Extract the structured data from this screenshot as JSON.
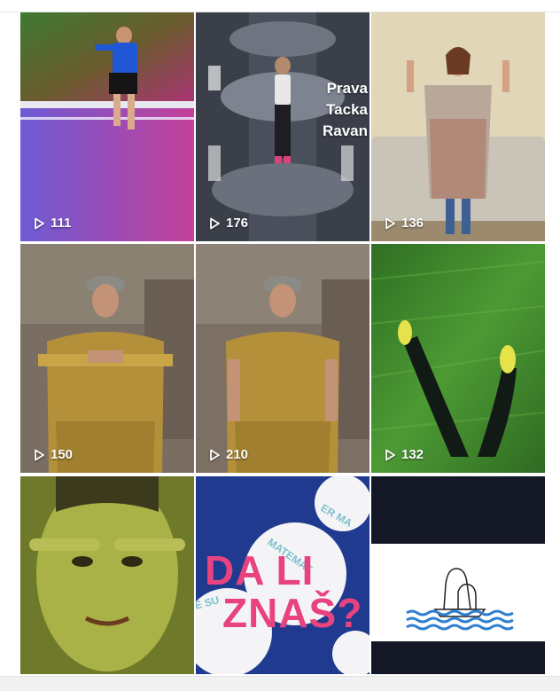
{
  "grid": {
    "tiles": [
      {
        "id": "video-1",
        "views": "111"
      },
      {
        "id": "video-2",
        "views": "176",
        "overlay_lines": [
          "Prava",
          "Tacka",
          "Ravan"
        ]
      },
      {
        "id": "video-3",
        "views": "136"
      },
      {
        "id": "video-4",
        "views": "150"
      },
      {
        "id": "video-5",
        "views": "210"
      },
      {
        "id": "video-6",
        "views": "132"
      },
      {
        "id": "video-7"
      },
      {
        "id": "video-8",
        "title_lines": [
          "DA LI",
          "ZNAŠ?"
        ]
      },
      {
        "id": "video-9"
      }
    ]
  },
  "icons": {
    "views": "play-outline-icon"
  },
  "colors": {
    "accent_pink": "#e8437f",
    "navy": "#1f3a8f",
    "grass": "#3f8a2a"
  }
}
